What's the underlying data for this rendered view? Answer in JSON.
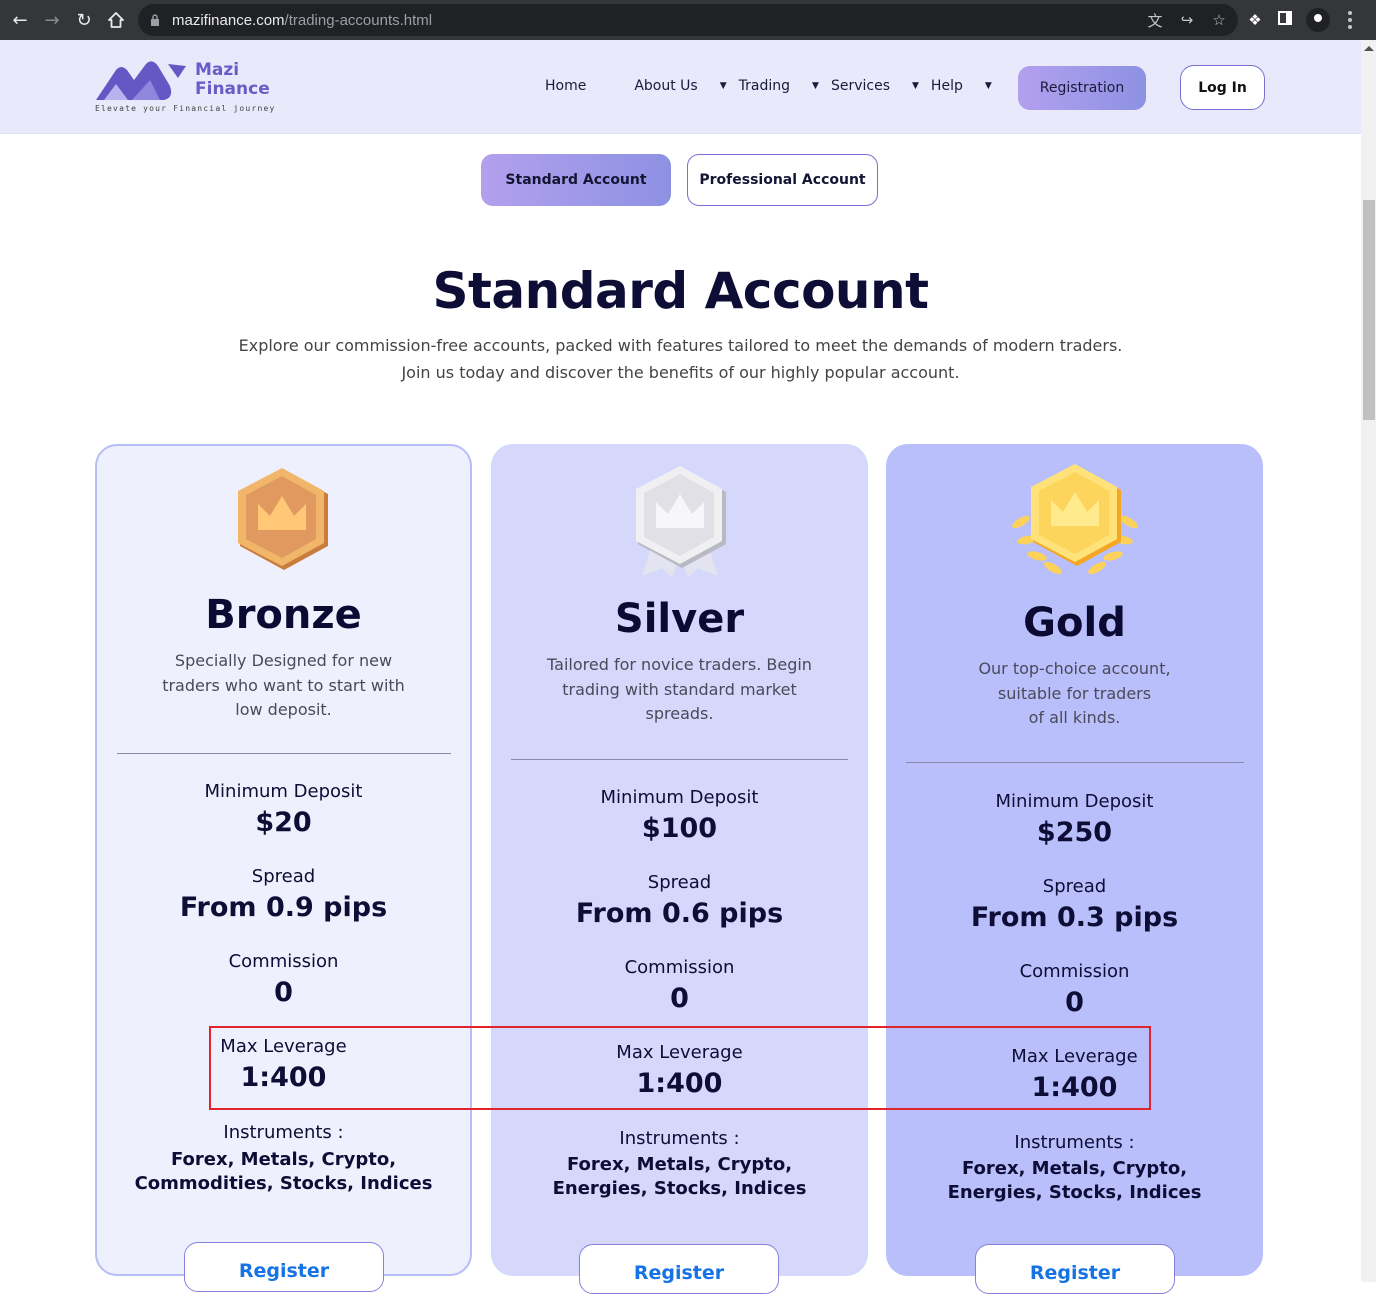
{
  "browser": {
    "url_domain": "mazifinance.com",
    "url_path": "/trading-accounts.html"
  },
  "header": {
    "brand_line1": "Mazi",
    "brand_line2": "Finance",
    "tagline": "Elevate your Financial journey",
    "nav": [
      {
        "label": "Home",
        "has_dropdown": false
      },
      {
        "label": "About Us",
        "has_dropdown": true
      },
      {
        "label": "Trading",
        "has_dropdown": true
      },
      {
        "label": "Services",
        "has_dropdown": true
      },
      {
        "label": "Help",
        "has_dropdown": true
      }
    ],
    "registration_label": "Registration",
    "login_label": "Log In"
  },
  "account_tabs": {
    "standard_label": "Standard Account",
    "professional_label": "Professional Account",
    "active": "standard"
  },
  "page": {
    "title": "Standard Account",
    "intro_line1": "Explore our commission-free accounts, packed with features tailored to meet the demands of modern traders.",
    "intro_line2": "Join us today and discover the benefits of our highly popular account."
  },
  "labels": {
    "min_deposit": "Minimum Deposit",
    "spread": "Spread",
    "commission": "Commission",
    "max_leverage": "Max Leverage",
    "instruments": "Instruments :",
    "register": "Register"
  },
  "cards": [
    {
      "name": "Bronze",
      "medal_icon": "bronze-medal-icon",
      "desc_lines": [
        "Specially Designed for new",
        "traders who want to start with",
        "low deposit."
      ],
      "min_deposit": "$20",
      "spread": "From 0.9 pips",
      "commission": "0",
      "max_leverage": "1:400",
      "instruments_line1": "Forex, Metals, Crypto,",
      "instruments_line2": "Commodities, Stocks, Indices"
    },
    {
      "name": "Silver",
      "medal_icon": "silver-medal-icon",
      "desc_lines": [
        "Tailored for novice traders. Begin",
        "trading with standard market",
        "spreads."
      ],
      "min_deposit": "$100",
      "spread": "From 0.6 pips",
      "commission": "0",
      "max_leverage": "1:400",
      "instruments_line1": "Forex, Metals, Crypto,",
      "instruments_line2": "Energies, Stocks, Indices"
    },
    {
      "name": "Gold",
      "medal_icon": "gold-medal-icon",
      "desc_lines": [
        "Our top-choice account,",
        "suitable for traders",
        "of all kinds."
      ],
      "min_deposit": "$250",
      "spread": "From 0.3 pips",
      "commission": "0",
      "max_leverage": "1:400",
      "instruments_line1": "Forex, Metals, Crypto,",
      "instruments_line2": "Energies, Stocks, Indices"
    }
  ],
  "colors": {
    "accent_gradient_start": "#b3a0ee",
    "accent_gradient_end": "#8d91e3",
    "highlight_box": "#e0242b",
    "register_text": "#1673e6"
  }
}
